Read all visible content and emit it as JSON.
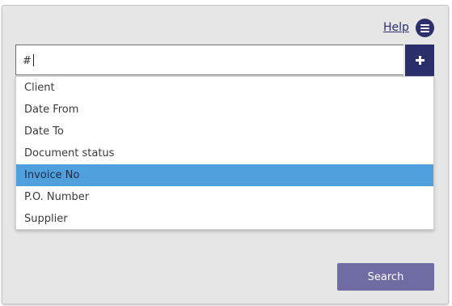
{
  "header": {
    "help_label": "Help",
    "menu_icon": "hamburger-menu-icon"
  },
  "search": {
    "value": "#",
    "add_icon": "plus-icon"
  },
  "dropdown": {
    "items": [
      {
        "label": "Client"
      },
      {
        "label": "Date From"
      },
      {
        "label": "Date To"
      },
      {
        "label": "Document status"
      },
      {
        "label": "Invoice No",
        "highlighted": true
      },
      {
        "label": "P.O. Number"
      },
      {
        "label": "Supplier"
      }
    ]
  },
  "actions": {
    "search_label": "Search"
  },
  "colors": {
    "brand": "#2b2f6b",
    "highlight": "#4fa0dc",
    "search_button": "#6e6ca3",
    "panel": "#e6e6e6"
  }
}
